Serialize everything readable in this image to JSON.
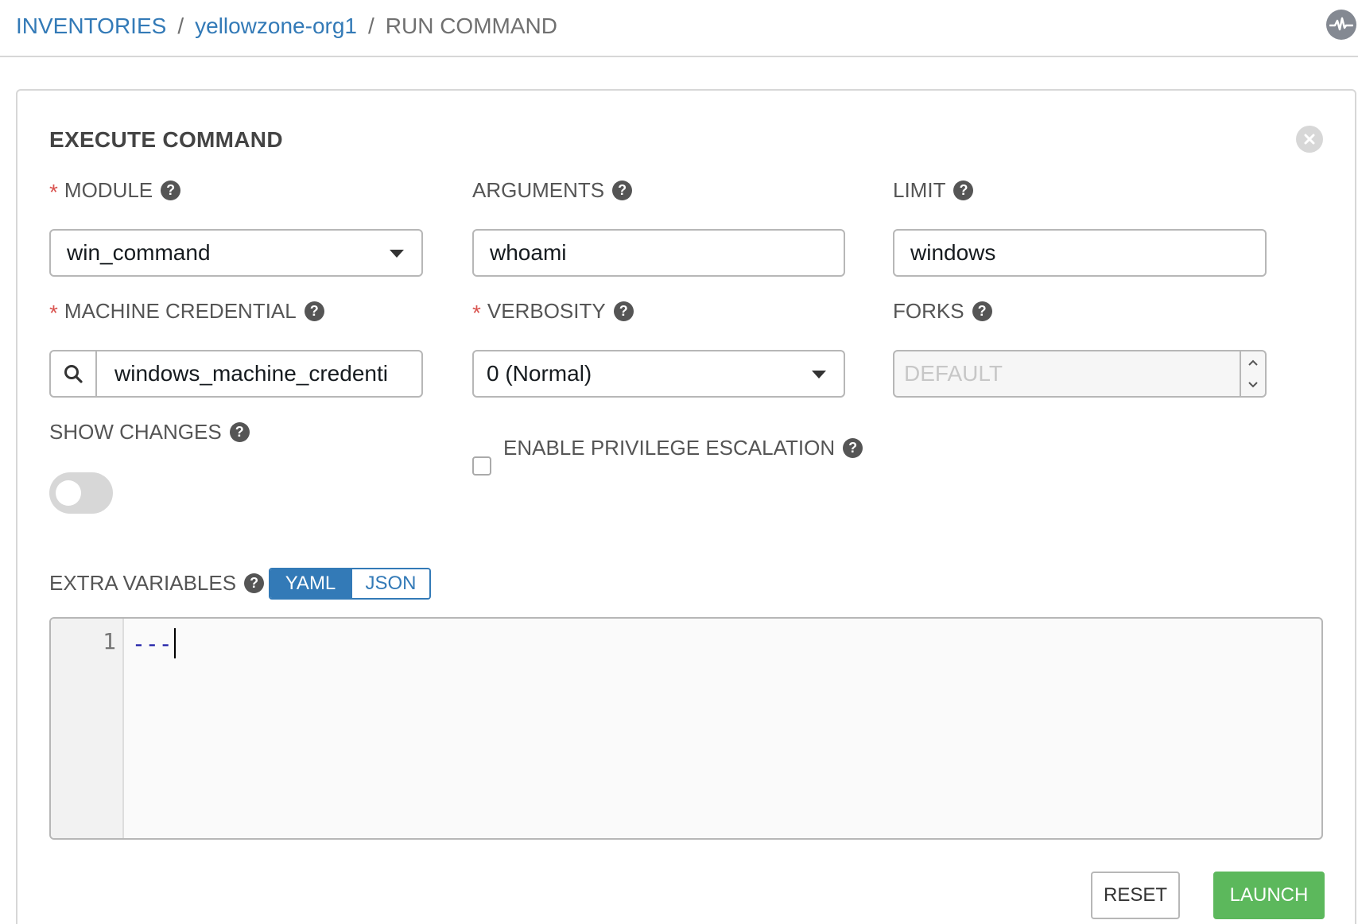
{
  "breadcrumb": {
    "inventories": "INVENTORIES",
    "sep1": "/",
    "inventory": "yellowzone-org1",
    "sep2": "/",
    "current": "RUN COMMAND"
  },
  "header": {
    "activity_icon": "activity-stream-icon"
  },
  "panel": {
    "title": "EXECUTE COMMAND",
    "close_icon": "close-icon"
  },
  "fields": {
    "module": {
      "label": "MODULE",
      "required": "*",
      "value": "win_command"
    },
    "arguments": {
      "label": "ARGUMENTS",
      "value": "whoami"
    },
    "limit": {
      "label": "LIMIT",
      "value": "windows"
    },
    "machine_credential": {
      "label": "MACHINE CREDENTIAL",
      "required": "*",
      "value": "windows_machine_credenti"
    },
    "verbosity": {
      "label": "VERBOSITY",
      "required": "*",
      "value": "0 (Normal)"
    },
    "forks": {
      "label": "FORKS",
      "placeholder": "DEFAULT"
    },
    "show_changes": {
      "label": "SHOW CHANGES",
      "on": false
    },
    "privilege_escalation": {
      "label": "ENABLE PRIVILEGE ESCALATION",
      "checked": false
    },
    "extra_variables": {
      "label": "EXTRA VARIABLES",
      "formats": [
        "YAML",
        "JSON"
      ],
      "selected_format": "YAML",
      "line_number": "1",
      "content": "---"
    }
  },
  "help_glyph": "?",
  "actions": {
    "reset": "RESET",
    "launch": "LAUNCH"
  },
  "colors": {
    "link": "#337ab7",
    "required": "#d9534f",
    "launch": "#5cb85c"
  }
}
